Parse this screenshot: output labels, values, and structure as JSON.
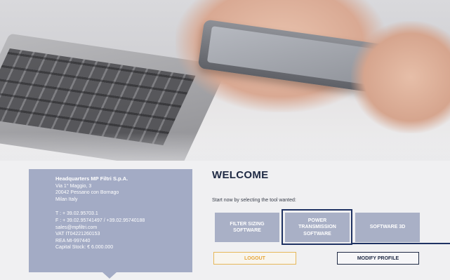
{
  "headquarters": {
    "title": "Headquarters MP Filtri S.p.A.",
    "address_line1": "Via 1° Maggio, 3",
    "address_line2": "20042 Pessano con Bornago",
    "address_line3": "Milan   Italy",
    "phone": "T : + 39.02.95703.1",
    "fax": "F : + 39.02.95741497 / +39.02.95740188",
    "email": "sales@mpfiltri.com",
    "vat": "VAT IT04221260153",
    "rea": "REA MI-997440",
    "capital": "Capital Stock: € 6.000.000"
  },
  "welcome": {
    "title": "WELCOME",
    "instruction": "Start now by selecting the tool wanted:"
  },
  "tools": [
    {
      "line1": "FILTER SIZING",
      "line2": "SOFTWARE",
      "line3": ""
    },
    {
      "line1": "POWER",
      "line2": "TRANSMISSION",
      "line3": "SOFTWARE"
    },
    {
      "line1": "SOFTWARE 3D",
      "line2": "",
      "line3": ""
    }
  ],
  "actions": {
    "logout": "LOGOUT",
    "modify_profile": "MODIFY PROFILE"
  },
  "colors": {
    "card": "#a3abc5",
    "tool_button": "#a9b0c6",
    "selection": "#1f3263",
    "logout_accent": "#e6a63a"
  }
}
